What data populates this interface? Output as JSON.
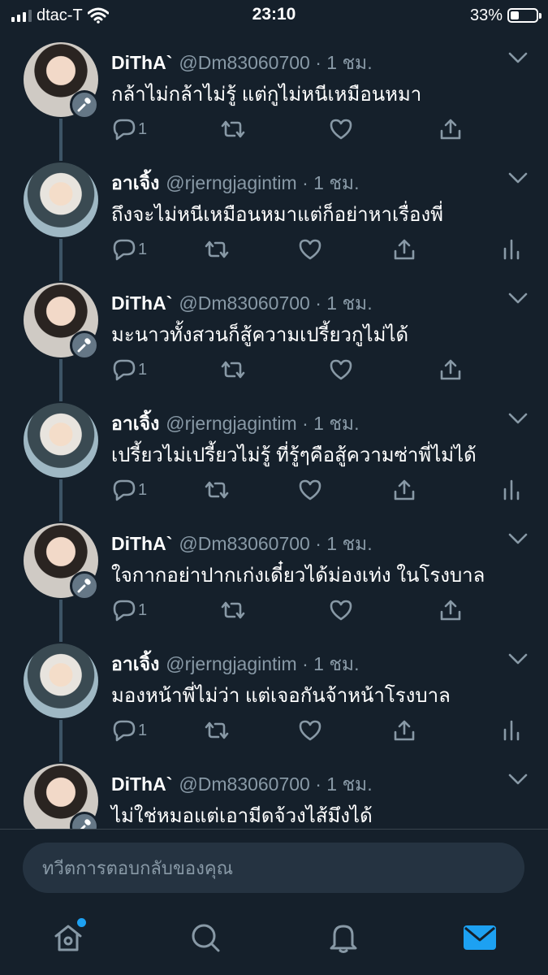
{
  "status_bar": {
    "carrier": "dtac-T",
    "time": "23:10",
    "battery_percent_label": "33%",
    "battery_level": 0.33
  },
  "colors": {
    "background": "#15202b",
    "secondary_text": "#8899a6",
    "accent": "#1da1f2",
    "thread_line": "#3d5466"
  },
  "tweets": [
    {
      "name": "DiThA`",
      "handle": "@Dm83060700 · 1 ชม.",
      "text": "กล้าไม่กล้าไม่รู้ แต่กูไม่หนีเหมือนหมา",
      "reply_count": "1",
      "avatar": "dita",
      "has_mic_badge": true,
      "has_analytics": false
    },
    {
      "name": "อาเจิ้ง",
      "handle": "@rjerngjagintim · 1 ชม.",
      "text": "ถึงจะไม่หนีเหมือนหมาแต่ก็อย่าหาเรื่องพี่",
      "reply_count": "1",
      "avatar": "arjeng",
      "has_mic_badge": false,
      "has_analytics": true
    },
    {
      "name": "DiThA`",
      "handle": "@Dm83060700 · 1 ชม.",
      "text": "มะนาวทั้งสวนก็สู้ความเปรี้ยวกูไม่ได้",
      "reply_count": "1",
      "avatar": "dita",
      "has_mic_badge": true,
      "has_analytics": false
    },
    {
      "name": "อาเจิ้ง",
      "handle": "@rjerngjagintim · 1 ชม.",
      "text": "เปรี้ยวไม่เปรี้ยวไม่รู้ ที่รู้ๆคือสู้ความซ่าพี่ไม่ได้",
      "reply_count": "1",
      "avatar": "arjeng",
      "has_mic_badge": false,
      "has_analytics": true
    },
    {
      "name": "DiThA`",
      "handle": "@Dm83060700 · 1 ชม.",
      "text": "ใจกากอย่าปากเก่งเดี๋ยวได้ม่องเท่ง ในโรงบาล",
      "reply_count": "1",
      "avatar": "dita",
      "has_mic_badge": true,
      "has_analytics": false
    },
    {
      "name": "อาเจิ้ง",
      "handle": "@rjerngjagintim · 1 ชม.",
      "text": "มองหน้าพี่ไม่ว่า แต่เจอกันจ้าหน้าโรงบาล",
      "reply_count": "1",
      "avatar": "arjeng",
      "has_mic_badge": false,
      "has_analytics": true
    },
    {
      "name": "DiThA`",
      "handle": "@Dm83060700 · 1 ชม.",
      "text": "ไม่ใช่หมอแต่เอามีดจ้วงไส้มึงได้",
      "reply_count": "",
      "avatar": "dita",
      "has_mic_badge": true,
      "has_analytics": false
    }
  ],
  "reply_box": {
    "placeholder": "ทวีตการตอบกลับของคุณ"
  },
  "tab_bar": {
    "items": [
      {
        "icon": "home-icon",
        "active": false,
        "has_notification_dot": true
      },
      {
        "icon": "search-icon",
        "active": false
      },
      {
        "icon": "bell-icon",
        "active": false
      },
      {
        "icon": "mail-icon",
        "active": true
      }
    ]
  }
}
